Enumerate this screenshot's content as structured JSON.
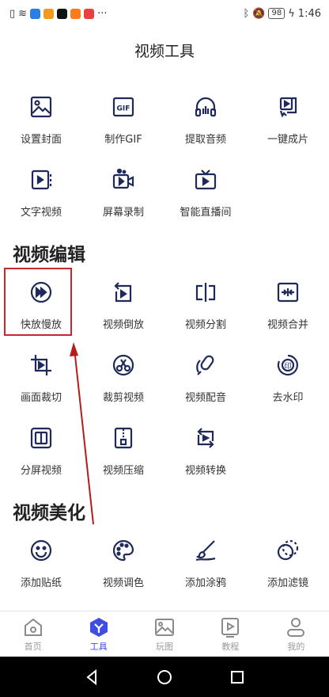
{
  "statusbar": {
    "battery": "98",
    "time": "1:46",
    "more": "···"
  },
  "page_title": "视频工具",
  "groups": [
    {
      "items": [
        {
          "label": "设置封面",
          "icon": "image-cover-icon"
        },
        {
          "label": "制作GIF",
          "icon": "gif-icon"
        },
        {
          "label": "提取音频",
          "icon": "headphones-icon"
        },
        {
          "label": "一键成片",
          "icon": "play-pointer-icon"
        }
      ]
    },
    {
      "items": [
        {
          "label": "文字视频",
          "icon": "text-video-icon"
        },
        {
          "label": "屏幕录制",
          "icon": "screen-record-icon"
        },
        {
          "label": "智能直播间",
          "icon": "live-tv-icon"
        }
      ]
    }
  ],
  "sections": [
    {
      "title": "视频编辑"
    },
    {
      "title": "视频美化"
    }
  ],
  "edit_items": [
    {
      "label": "快放慢放",
      "icon": "fast-forward-icon"
    },
    {
      "label": "视频倒放",
      "icon": "reverse-play-icon"
    },
    {
      "label": "视频分割",
      "icon": "split-icon"
    },
    {
      "label": "视频合并",
      "icon": "merge-icon"
    },
    {
      "label": "画面裁切",
      "icon": "crop-icon"
    },
    {
      "label": "裁剪视频",
      "icon": "scissors-icon"
    },
    {
      "label": "视频配音",
      "icon": "microphone-icon"
    },
    {
      "label": "去水印",
      "icon": "watermark-icon"
    },
    {
      "label": "分屏视频",
      "icon": "split-screen-icon"
    },
    {
      "label": "视频压缩",
      "icon": "compress-icon"
    },
    {
      "label": "视频转换",
      "icon": "convert-icon"
    }
  ],
  "beauty_items": [
    {
      "label": "添加贴纸",
      "icon": "sticker-icon"
    },
    {
      "label": "视频调色",
      "icon": "palette-icon"
    },
    {
      "label": "添加涂鸦",
      "icon": "brush-icon"
    },
    {
      "label": "添加滤镜",
      "icon": "filter-icon"
    }
  ],
  "nav": [
    {
      "label": "首页",
      "icon": "home-icon"
    },
    {
      "label": "工具",
      "icon": "tools-icon",
      "active": true
    },
    {
      "label": "玩图",
      "icon": "picture-icon"
    },
    {
      "label": "教程",
      "icon": "tutorial-icon"
    },
    {
      "label": "我的",
      "icon": "profile-icon"
    }
  ],
  "colors": {
    "accent": "#3f4ee0",
    "icon": "#1f2a5a",
    "highlight": "#c62828"
  }
}
